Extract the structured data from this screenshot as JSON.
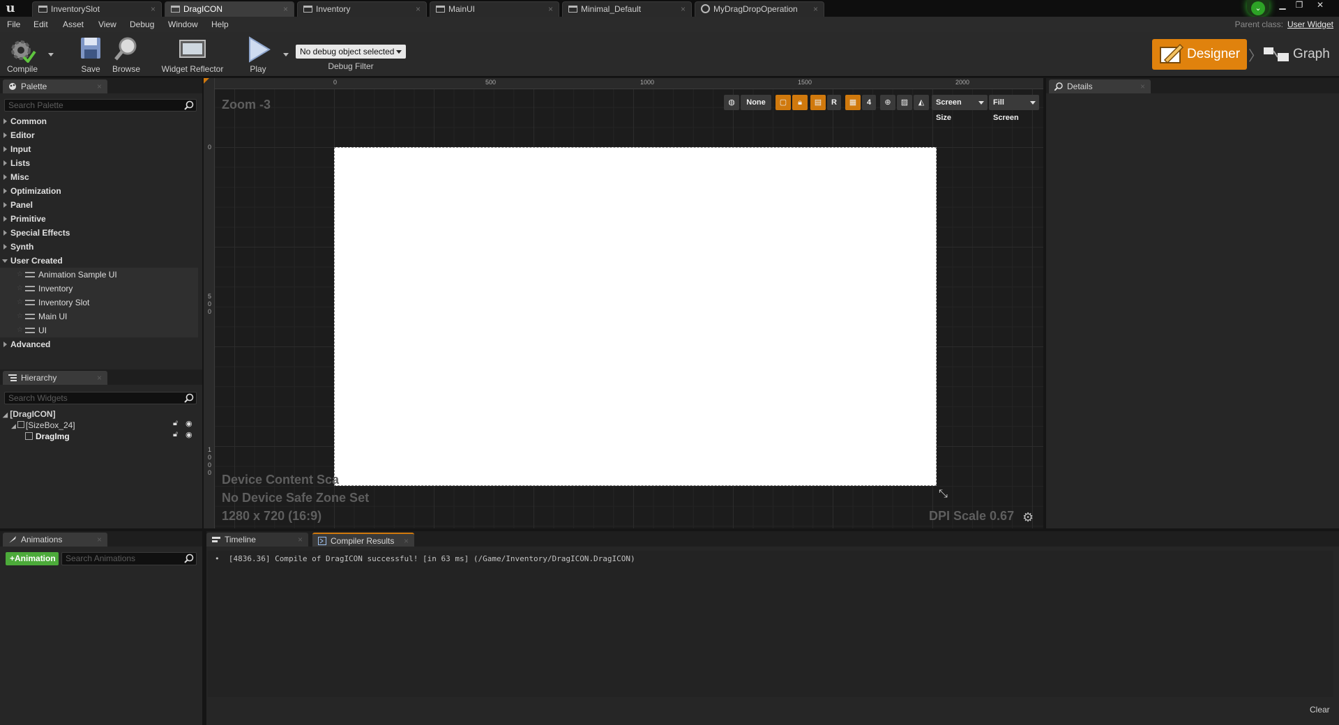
{
  "window": {
    "tabs": [
      {
        "label": "InventorySlot"
      },
      {
        "label": "DragICON"
      },
      {
        "label": "Inventory"
      },
      {
        "label": "MainUI"
      },
      {
        "label": "Minimal_Default"
      },
      {
        "label": "MyDragDropOperation"
      }
    ],
    "active_tab": "DragICON"
  },
  "menu": {
    "items": [
      "File",
      "Edit",
      "Asset",
      "View",
      "Debug",
      "Window",
      "Help"
    ],
    "parent_class_label": "Parent class:",
    "parent_class_value": "User Widget"
  },
  "toolbar": {
    "compile": "Compile",
    "save": "Save",
    "browse": "Browse",
    "widget_reflector": "Widget Reflector",
    "play": "Play",
    "debug_select": "No debug object selected",
    "debug_filter": "Debug Filter",
    "designer": "Designer",
    "graph": "Graph"
  },
  "palette": {
    "tab": "Palette",
    "search_placeholder": "Search Palette",
    "categories": [
      "Common",
      "Editor",
      "Input",
      "Lists",
      "Misc",
      "Optimization",
      "Panel",
      "Primitive",
      "Special Effects",
      "Synth",
      "User Created"
    ],
    "user_created_items": [
      "Animation Sample UI",
      "Inventory",
      "Inventory Slot",
      "Main UI",
      "UI"
    ],
    "advanced": "Advanced"
  },
  "hierarchy": {
    "tab": "Hierarchy",
    "search_placeholder": "Search Widgets",
    "root": "[DragICON]",
    "size_box": "[SizeBox_24]",
    "image": "DragImg"
  },
  "canvas": {
    "zoom": "Zoom -3",
    "ruler_top": [
      "0",
      "500",
      "1000",
      "1500",
      "2000"
    ],
    "ruler_left": [
      "0",
      "5 0 0",
      "1 0 0 0"
    ],
    "toolbar": {
      "none": "None",
      "r": "R",
      "grid_count": "4",
      "screen_size": "Screen Size",
      "fill_screen": "Fill Screen"
    },
    "device_content_scale": "Device Content Sca",
    "safe_zone": "No Device Safe Zone Set",
    "resolution": "1280 x 720 (16:9)",
    "dpi_scale": "DPI Scale 0.67"
  },
  "details": {
    "tab": "Details"
  },
  "animations": {
    "tab": "Animations",
    "add_button": "Animation",
    "search_placeholder": "Search Animations"
  },
  "bottom_tabs": {
    "timeline": "Timeline",
    "compiler_results": "Compiler Results"
  },
  "compiler": {
    "log": "[4836.36] Compile of DragICON successful! [in 63 ms] (/Game/Inventory/DragICON.DragICON)",
    "clear": "Clear"
  },
  "colors": {
    "accent": "#e0820d",
    "add_green": "#4caa3a",
    "canvas_bg": "#1c1c1c"
  }
}
